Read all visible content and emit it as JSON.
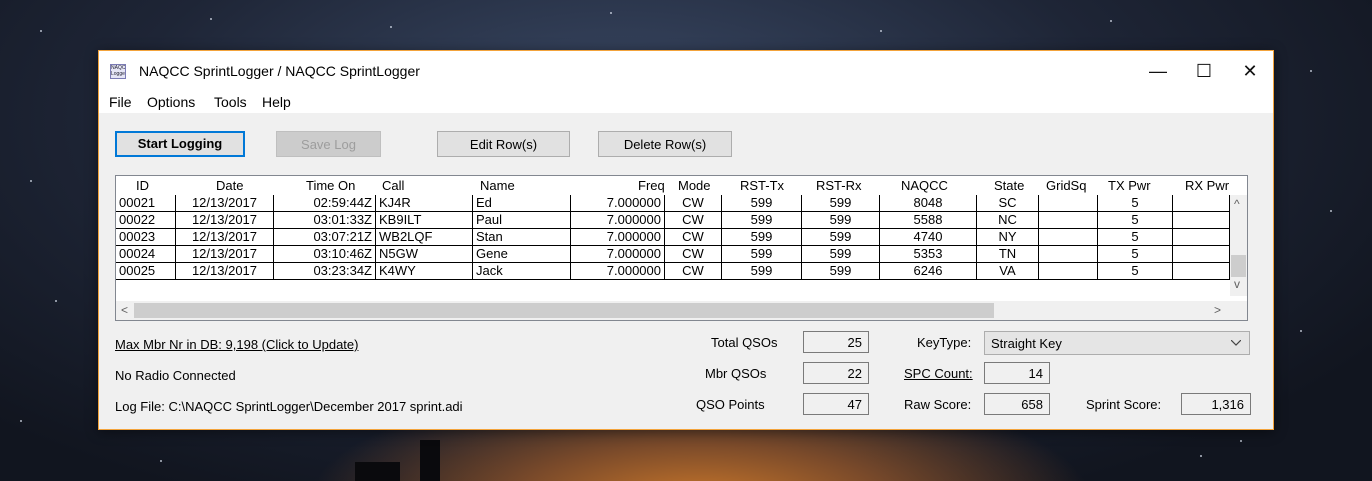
{
  "window": {
    "title": "NAQCC SprintLogger / NAQCC SprintLogger",
    "icon_text": "NAQCC Logger",
    "controls": {
      "minimize": "—",
      "maximize": "☐",
      "close": "✕"
    }
  },
  "menu": [
    "File",
    "Options",
    "Tools",
    "Help"
  ],
  "toolbar": {
    "start_logging": "Start Logging",
    "save_log": "Save Log",
    "edit_rows": "Edit Row(s)",
    "delete_rows": "Delete Row(s)"
  },
  "grid": {
    "columns": [
      "ID",
      "Date",
      "Time On",
      "Call",
      "Name",
      "Freq",
      "Mode",
      "RST-Tx",
      "RST-Rx",
      "NAQCC",
      "State",
      "GridSq",
      "TX Pwr",
      "RX Pwr"
    ],
    "rows": [
      [
        "00021",
        "12/13/2017",
        "02:59:44Z",
        "KJ4R",
        "Ed",
        "7.000000",
        "CW",
        "599",
        "599",
        "8048",
        "SC",
        "",
        "5",
        ""
      ],
      [
        "00022",
        "12/13/2017",
        "03:01:33Z",
        "KB9ILT",
        "Paul",
        "7.000000",
        "CW",
        "599",
        "599",
        "5588",
        "NC",
        "",
        "5",
        ""
      ],
      [
        "00023",
        "12/13/2017",
        "03:07:21Z",
        "WB2LQF",
        "Stan",
        "7.000000",
        "CW",
        "599",
        "599",
        "4740",
        "NY",
        "",
        "5",
        ""
      ],
      [
        "00024",
        "12/13/2017",
        "03:10:46Z",
        "N5GW",
        "Gene",
        "7.000000",
        "CW",
        "599",
        "599",
        "5353",
        "TN",
        "",
        "5",
        ""
      ],
      [
        "00025",
        "12/13/2017",
        "03:23:34Z",
        "K4WY",
        "Jack",
        "7.000000",
        "CW",
        "599",
        "599",
        "6246",
        "VA",
        "",
        "5",
        ""
      ]
    ],
    "scroll_up": "^",
    "scroll_down": "v",
    "scroll_left": "<",
    "scroll_right": ">"
  },
  "status": {
    "max_mbr": "Max Mbr Nr in DB: 9,198  (Click to Update)",
    "radio": "No Radio Connected",
    "log_file": "Log File: C:\\NAQCC SprintLogger\\December 2017 sprint.adi"
  },
  "stats": {
    "total_qsos_label": "Total QSOs",
    "total_qsos": "25",
    "mbr_qsos_label": "Mbr QSOs",
    "mbr_qsos": "22",
    "qso_points_label": "QSO Points",
    "qso_points": "47",
    "keytype_label": "KeyType:",
    "keytype": "Straight Key",
    "spc_count_label": "SPC Count:",
    "spc_count": "14",
    "raw_score_label": "Raw Score:",
    "raw_score": "658",
    "sprint_score_label": "Sprint Score:",
    "sprint_score": "1,316"
  }
}
